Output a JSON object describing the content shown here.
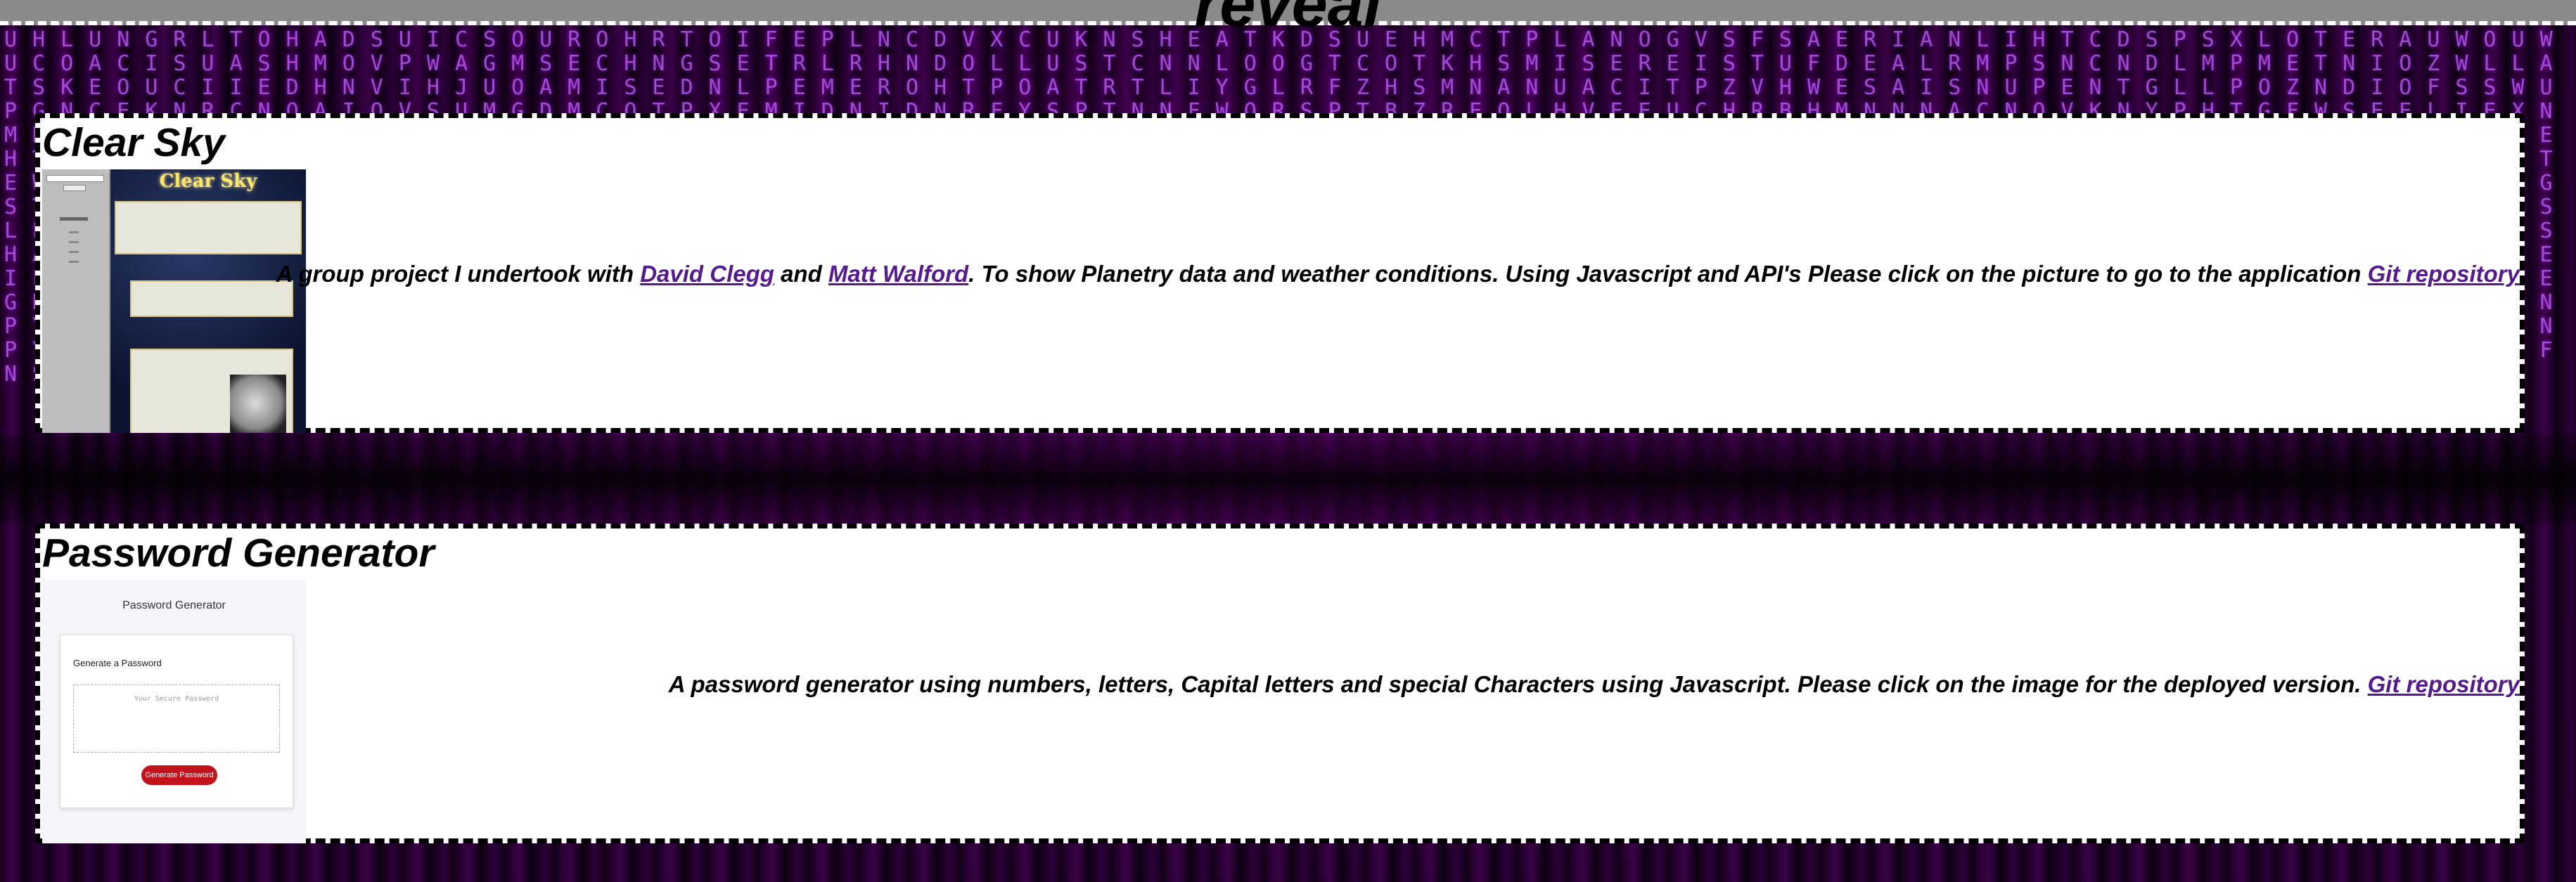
{
  "header": {
    "title": "reveal"
  },
  "background": {
    "glyph_text": "SEUHNSIEHNISNCSCAVDOMSOLIERUWERGTFCAPREXALVEDDTPDPVHOESIRBONCOMSTAECHMILHCEPSSFSCTTIXOSMOCOUHLUNGRLTOHADSUICSOUROHRTOIFEPLNCDVXCUKNSHEATKDSUEHMCTPLANOGVSFSAERIANLIHTCDSPSXLOTERAUWOUWUCOACISUASHMOVPWAGMSECHNGSETRLRHNDOLLUSTCNNLOOGTCOTKHSMISEREISTUFDEALRMPSNCNDLMPMETNIOZWLLATSKEOUCIIEDHNVIHJUOAMISEDNLPEMEROHTPOATRTLIYGLRFZHSMNANUACITPZVHWESAISNUPENTGLLPOZNDIOFSSWUPGNCEKNRCNOAIOVSUMGDMCOTPXEMIDNIDNRFYSPTNNFWORSPTBZREOLHVEEUCHRBHMNNNACNOVKNYPHTGFWSEELIEXNMDUFCOWMTDIMMAOCRTSLAOBDSEZNBESTRNPIOSITTASRLIUGDEOLMDNCLOKBEIEAHWHYRCMPCIAEPNESDGORDOMRWAEHTLNMCODCFEDSMRSEIALRUBSOHUEDWPSOAHNERPOITEIAADKEREWFPGOIUDIFVAHNHNSTPECTMLFHAOLUDRTEOAUIITEWDSUNTSIUMOAPSANOPSIRENEDBLINLDOXRCUVEOWUISHDLGTAPYROLAPMRNEICOEMHRIAHPOHNFIMNHFPSVORDWTAGSTUCDLSHIAHRSHUCOSBDSENRTUCEGSTIAULFMEARLPDOMOFMKNGEBYSRHPOEWAHIECNUSNLOHEPCTUDDCRGAOAIMVNSLEOPIGTLRMTEAIUWSFOUHCONPTDSHRALNKUOYIMVSEDMUFTCETAOPWNLERKSLCBIEHGRONPUSTIACDYTUMNOVHEDWASHALSTRNFUGOIPDECKMOEMLOWNIYSRTHAFCEBUDNPGOSLTERHIWAMUOCVNDEYATSFLOPKHRUMGCIENDOWLSTAHBPYRUEIFNCOMSDVTLAHGEKRWPUONISTCLDEMFAYHBORUNVGTSAPWEIKCLDMOHFRYNUTSBEAGOVLPICWDHEMRNKSUTFOAYLBPEGHDCRIVNOWMTUSKAEFLHYOPBIDGRNCSETVMUWLAKOFHPYDBINRGEUSCWTOMLVAHKFEPYDSNBRGIUOTCLEWMHAVKFSONPYDBRIGUTELCWAMSHVKOFNPYDEBRGISUTLCAWOMHVFKNEPYSDBRGIUOTCLWAEMHSVKFNOPYDBRGEIUTLSCAWMOHVKFNPYEDBRSGIUTCOLWAMHVEKFSNPYDBORGIUTCLWEAMSHVKFNOPYDBRGEIUTSLCAWMHOVKFNPYDEBRGSIUTCLOWAMHVKEFNSPYDBROGIUTCLWAEMHSVKFNOPYDBRGIUTEL"
  },
  "projects": [
    {
      "title": "Clear Sky",
      "thumbnail_title": "Clear Sky",
      "desc_pre": "A group project I undertook with ",
      "link1": "David Clegg",
      "desc_mid1": " and ",
      "link2": "Matt Walford",
      "desc_mid2": ". To show Planetry data and weather conditions. Using Javascript and API's Please click on the picture to go to the application ",
      "repo_link": "Git repository"
    },
    {
      "title": "Password Generator",
      "thumbnail_title": "Password Generator",
      "thumbnail_card_title": "Generate a Password",
      "thumbnail_placeholder": "Your Secure Password",
      "thumbnail_button": "Generate Password",
      "desc_pre": "A password generator using numbers, letters, Capital letters and special Characters using Javascript. Please click on the image for the deployed version. ",
      "repo_link": "Git repository"
    }
  ],
  "colors": {
    "link": "#551a8b",
    "card_bg": "#ffffff",
    "topbar": "#8a8a8a",
    "glyph": "#c36bff"
  }
}
